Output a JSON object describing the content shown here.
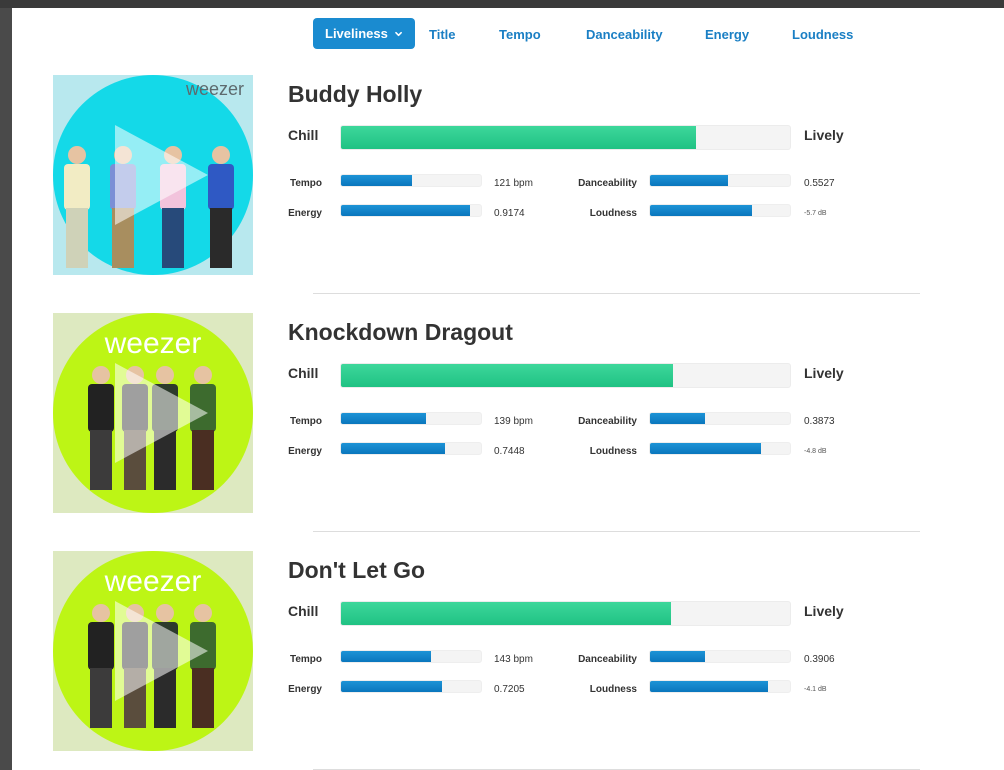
{
  "nav": {
    "active": "Liveliness",
    "items": [
      "Title",
      "Tempo",
      "Danceability",
      "Energy",
      "Loudness"
    ]
  },
  "labels": {
    "chill": "Chill",
    "lively": "Lively",
    "tempo": "Tempo",
    "energy": "Energy",
    "danceability": "Danceability",
    "loudness": "Loudness"
  },
  "colors": {
    "accent": "#1a8bd0",
    "liveliness_bar": "#2ccb8d",
    "metric_bar": "#1486c9"
  },
  "tracks": [
    {
      "title": "Buddy Holly",
      "album_logo": "weezer",
      "album_color": "#14d9e8",
      "liveliness": 0.79,
      "tempo": "121 bpm",
      "tempo_level": 0.51,
      "energy": "0.9174",
      "energy_level": 0.92,
      "danceability": "0.5527",
      "danceability_level": 0.56,
      "loudness": "-5.7 dB",
      "loudness_level": 0.73
    },
    {
      "title": "Knockdown Dragout",
      "album_logo": "weezer",
      "album_color": "#bdf515",
      "liveliness": 0.74,
      "tempo": "139 bpm",
      "tempo_level": 0.61,
      "energy": "0.7448",
      "energy_level": 0.74,
      "danceability": "0.3873",
      "danceability_level": 0.39,
      "loudness": "-4.8 dB",
      "loudness_level": 0.79
    },
    {
      "title": "Don't Let Go",
      "album_logo": "weezer",
      "album_color": "#bdf515",
      "liveliness": 0.735,
      "tempo": "143 bpm",
      "tempo_level": 0.64,
      "energy": "0.7205",
      "energy_level": 0.72,
      "danceability": "0.3906",
      "danceability_level": 0.39,
      "loudness": "-4.1 dB",
      "loudness_level": 0.84
    }
  ]
}
